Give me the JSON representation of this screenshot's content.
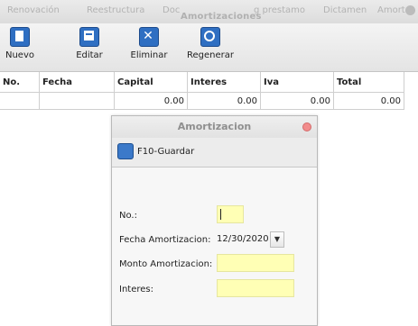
{
  "menu_tabs": [
    "Renovación",
    "Reestructura",
    "Doc",
    "g prestamo",
    "Dictamen",
    "Amort"
  ],
  "window_title": "Amortizaciones",
  "toolbar": {
    "nuevo": "Nuevo",
    "editar": "Editar",
    "eliminar": "Eliminar",
    "regenerar": "Regenerar"
  },
  "grid": {
    "headers": [
      "No.",
      "Fecha",
      "Capital",
      "Interes",
      "Iva",
      "Total"
    ],
    "rows": [
      [
        "",
        "",
        "0.00",
        "0.00",
        "0.00",
        "0.00"
      ]
    ]
  },
  "dialog": {
    "title": "Amortizacion",
    "save_label": "F10-Guardar",
    "fields": {
      "no_label": "No.:",
      "fecha_label": "Fecha Amortizacion:",
      "fecha_value": "12/30/2020",
      "monto_label": "Monto Amortizacion:",
      "interes_label": "Interes:"
    }
  },
  "colors": {
    "input_bg": "#ffffb5",
    "close_red": "#f28c8c"
  }
}
